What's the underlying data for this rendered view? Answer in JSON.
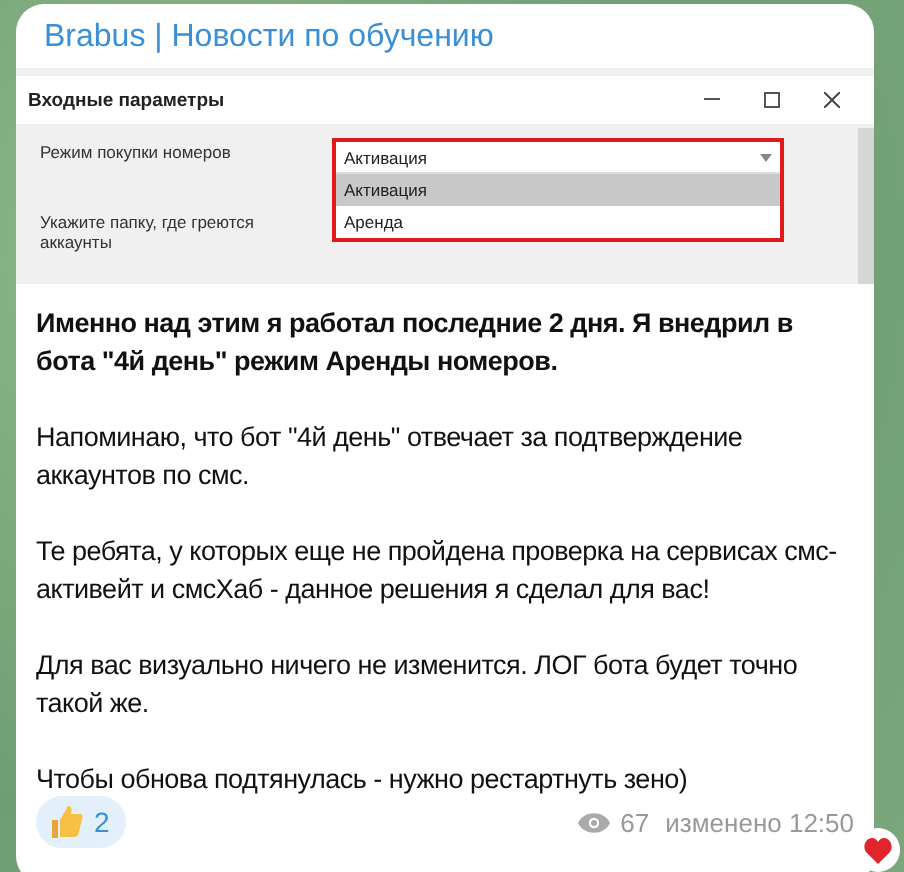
{
  "channel": {
    "title": "Brabus | Новости по обучению"
  },
  "screenshot": {
    "window_title": "Входные параметры",
    "fields": [
      {
        "kind": "select",
        "label": "Режим покупки номеров",
        "value": "Активация",
        "options": [
          {
            "label": "Активация",
            "selected": true
          },
          {
            "label": "Аренда",
            "selected": false
          }
        ]
      },
      {
        "kind": "folder",
        "label": "Укажите папку, где греются аккаунты"
      }
    ]
  },
  "message": {
    "paragraphs": [
      {
        "kind": "bold",
        "text": "Именно над этим я работал последние 2 дня. Я внедрил в бота \"4й день\" режим Аренды номеров."
      },
      {
        "kind": "normal",
        "text": "Напоминаю, что бот \"4й день\" отвечает за подтверждение аккаунтов по смс."
      },
      {
        "kind": "normal",
        "text": "Те ребята, у которых еще не пройдена проверка на сервисах смс-активейт и смсХаб - данное решения я сделал для вас!"
      },
      {
        "kind": "normal",
        "text": "Для вас визуально ничего не изменится. ЛОГ бота будет точно такой же."
      },
      {
        "kind": "normal",
        "text": "Чтобы обнова подтянулась - нужно рестартнуть зено)"
      }
    ]
  },
  "reactions": [
    {
      "count": "2",
      "selected": true
    }
  ],
  "views": "67",
  "edited": "изменено 12:50"
}
